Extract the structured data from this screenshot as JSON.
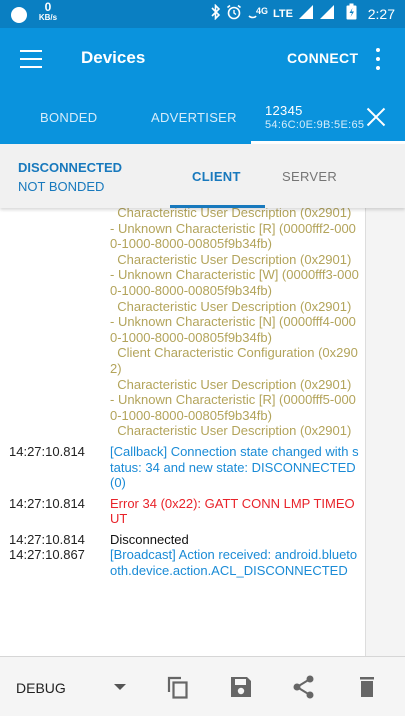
{
  "status_bar": {
    "speed_value": "0",
    "speed_unit": "KB/s",
    "network_type": "4G",
    "lte_label": "LTE",
    "time": "2:27"
  },
  "app_bar": {
    "title": "Devices",
    "connect_label": "CONNECT"
  },
  "tabs": {
    "bonded": "BONDED",
    "advertiser": "ADVERTISER",
    "device_name": "12345",
    "device_address": "54:6C:0E:9B:5E:65"
  },
  "connection": {
    "state": "DISCONNECTED",
    "bond_state": "NOT BONDED",
    "client_tab": "CLIENT",
    "server_tab": "SERVER"
  },
  "log": {
    "service_lines": [
      "  Characteristic User Description (0x2901)",
      "- Unknown Characteristic [R] (0000fff2-0000-1000-8000-00805f9b34fb)",
      "  Characteristic User Description (0x2901)",
      "- Unknown Characteristic [W] (0000fff3-0000-1000-8000-00805f9b34fb)",
      "  Characteristic User Description (0x2901)",
      "- Unknown Characteristic [N] (0000fff4-0000-1000-8000-00805f9b34fb)",
      "  Client Characteristic Configuration (0x2902)",
      "  Characteristic User Description (0x2901)",
      "- Unknown Characteristic [R] (0000fff5-0000-1000-8000-00805f9b34fb)",
      "  Characteristic User Description (0x2901)"
    ],
    "entries": [
      {
        "time": "14:27:10.814",
        "text": "[Callback] Connection state changed with status: 34 and new state: DISCONNECTED (0)",
        "color": "blue"
      },
      {
        "time": "14:27:10.814",
        "text": "Error 34 (0x22): GATT CONN LMP TIMEOUT",
        "color": "red"
      },
      {
        "time": "14:27:10.814",
        "text": "Disconnected",
        "color": "black"
      },
      {
        "time": "14:27:10.867",
        "text": "[Broadcast] Action received: android.bluetooth.device.action.ACL_DISCONNECTED",
        "color": "blue"
      }
    ]
  },
  "bottom_bar": {
    "log_level": "DEBUG"
  },
  "colors": {
    "status_bar": "#0a7fc2",
    "app_bar": "#0a93dd",
    "accent": "#1879bd",
    "log_service": "#b3a45b",
    "log_callback": "#1a8bd6",
    "log_error": "#e8232a"
  },
  "icons": [
    "menu-icon",
    "overflow-menu-icon",
    "close-icon",
    "bluetooth-icon",
    "alarm-icon",
    "volte-icon",
    "signal-icon",
    "battery-icon",
    "dropdown-arrow-icon",
    "copy-icon",
    "save-icon",
    "share-icon",
    "delete-icon"
  ]
}
